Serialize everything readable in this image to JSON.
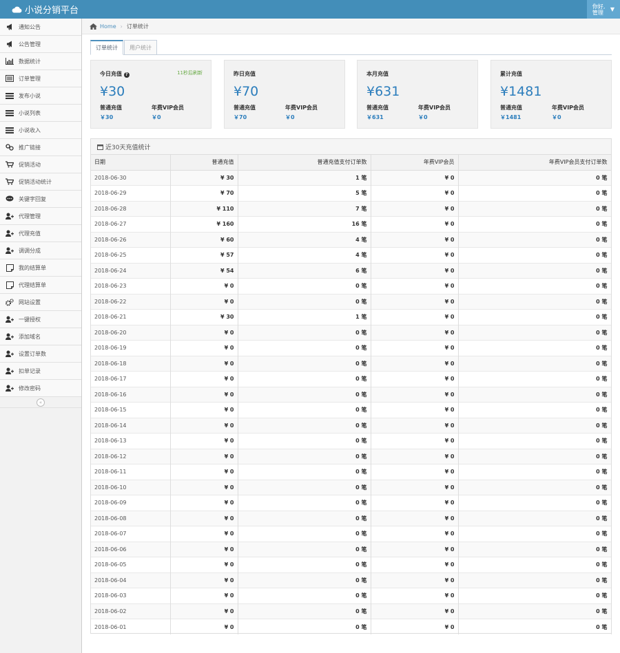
{
  "header": {
    "brand": "小说分销平台",
    "user_line1": "你好,",
    "user_line2": "管理"
  },
  "sidebar": {
    "items": [
      {
        "label": "通知公告",
        "icon": "bullhorn-icon"
      },
      {
        "label": "公告管理",
        "icon": "bullhorn-icon"
      },
      {
        "label": "数据统计",
        "icon": "bar-chart-icon"
      },
      {
        "label": "订单管理",
        "icon": "list-alt-icon"
      },
      {
        "label": "发布小说",
        "icon": "list-icon"
      },
      {
        "label": "小说列表",
        "icon": "list-icon"
      },
      {
        "label": "小说收入",
        "icon": "list-icon"
      },
      {
        "label": "推广链接",
        "icon": "link-icon"
      },
      {
        "label": "促销活动",
        "icon": "cart-icon"
      },
      {
        "label": "促销活动统计",
        "icon": "cart-icon"
      },
      {
        "label": "关键字回复",
        "icon": "comment-icon"
      },
      {
        "label": "代理管理",
        "icon": "user-plus-icon"
      },
      {
        "label": "代理充值",
        "icon": "user-plus-icon"
      },
      {
        "label": "调调分成",
        "icon": "user-plus-icon"
      },
      {
        "label": "我的结算单",
        "icon": "note-icon"
      },
      {
        "label": "代理结算单",
        "icon": "note-icon"
      },
      {
        "label": "网站设置",
        "icon": "cogs-icon"
      },
      {
        "label": "一键授权",
        "icon": "user-plus-icon"
      },
      {
        "label": "添加域名",
        "icon": "user-plus-icon"
      },
      {
        "label": "设置订单数",
        "icon": "user-plus-icon"
      },
      {
        "label": "扣单记录",
        "icon": "user-plus-icon"
      },
      {
        "label": "修改密码",
        "icon": "user-plus-icon"
      }
    ],
    "collapse_symbol": "«"
  },
  "breadcrumb": {
    "home": "Home",
    "current": "订单统计"
  },
  "tabs": [
    {
      "label": "订单统计",
      "active": true
    },
    {
      "label": "用户统计",
      "active": false
    }
  ],
  "stats": [
    {
      "title": "今日充值",
      "refresh": "11秒后刷新",
      "value": "¥30",
      "l1": "普通充值",
      "l2": "年费VIP会员",
      "v1": "￥30",
      "v2": "￥0"
    },
    {
      "title": "昨日充值",
      "refresh": "",
      "value": "¥70",
      "l1": "普通充值",
      "l2": "年费VIP会员",
      "v1": "￥70",
      "v2": "￥0"
    },
    {
      "title": "本月充值",
      "refresh": "",
      "value": "¥631",
      "l1": "普通充值",
      "l2": "年费VIP会员",
      "v1": "￥631",
      "v2": "￥0"
    },
    {
      "title": "累计充值",
      "refresh": "",
      "value": "¥1481",
      "l1": "普通充值",
      "l2": "年费VIP会员",
      "v1": "￥1481",
      "v2": "￥0"
    }
  ],
  "table": {
    "title": "近30天充值统计",
    "headers": [
      "日期",
      "普通充值",
      "普通充值支付订单数",
      "年费VIP会员",
      "年费VIP会员支付订单数"
    ],
    "rows": [
      [
        "2018-06-30",
        "¥ 30",
        "1 笔",
        "¥ 0",
        "0 笔"
      ],
      [
        "2018-06-29",
        "¥ 70",
        "5 笔",
        "¥ 0",
        "0 笔"
      ],
      [
        "2018-06-28",
        "¥ 110",
        "7 笔",
        "¥ 0",
        "0 笔"
      ],
      [
        "2018-06-27",
        "¥ 160",
        "16 笔",
        "¥ 0",
        "0 笔"
      ],
      [
        "2018-06-26",
        "¥ 60",
        "4 笔",
        "¥ 0",
        "0 笔"
      ],
      [
        "2018-06-25",
        "¥ 57",
        "4 笔",
        "¥ 0",
        "0 笔"
      ],
      [
        "2018-06-24",
        "¥ 54",
        "6 笔",
        "¥ 0",
        "0 笔"
      ],
      [
        "2018-06-23",
        "¥ 0",
        "0 笔",
        "¥ 0",
        "0 笔"
      ],
      [
        "2018-06-22",
        "¥ 0",
        "0 笔",
        "¥ 0",
        "0 笔"
      ],
      [
        "2018-06-21",
        "¥ 30",
        "1 笔",
        "¥ 0",
        "0 笔"
      ],
      [
        "2018-06-20",
        "¥ 0",
        "0 笔",
        "¥ 0",
        "0 笔"
      ],
      [
        "2018-06-19",
        "¥ 0",
        "0 笔",
        "¥ 0",
        "0 笔"
      ],
      [
        "2018-06-18",
        "¥ 0",
        "0 笔",
        "¥ 0",
        "0 笔"
      ],
      [
        "2018-06-17",
        "¥ 0",
        "0 笔",
        "¥ 0",
        "0 笔"
      ],
      [
        "2018-06-16",
        "¥ 0",
        "0 笔",
        "¥ 0",
        "0 笔"
      ],
      [
        "2018-06-15",
        "¥ 0",
        "0 笔",
        "¥ 0",
        "0 笔"
      ],
      [
        "2018-06-14",
        "¥ 0",
        "0 笔",
        "¥ 0",
        "0 笔"
      ],
      [
        "2018-06-13",
        "¥ 0",
        "0 笔",
        "¥ 0",
        "0 笔"
      ],
      [
        "2018-06-12",
        "¥ 0",
        "0 笔",
        "¥ 0",
        "0 笔"
      ],
      [
        "2018-06-11",
        "¥ 0",
        "0 笔",
        "¥ 0",
        "0 笔"
      ],
      [
        "2018-06-10",
        "¥ 0",
        "0 笔",
        "¥ 0",
        "0 笔"
      ],
      [
        "2018-06-09",
        "¥ 0",
        "0 笔",
        "¥ 0",
        "0 笔"
      ],
      [
        "2018-06-08",
        "¥ 0",
        "0 笔",
        "¥ 0",
        "0 笔"
      ],
      [
        "2018-06-07",
        "¥ 0",
        "0 笔",
        "¥ 0",
        "0 笔"
      ],
      [
        "2018-06-06",
        "¥ 0",
        "0 笔",
        "¥ 0",
        "0 笔"
      ],
      [
        "2018-06-05",
        "¥ 0",
        "0 笔",
        "¥ 0",
        "0 笔"
      ],
      [
        "2018-06-04",
        "¥ 0",
        "0 笔",
        "¥ 0",
        "0 笔"
      ],
      [
        "2018-06-03",
        "¥ 0",
        "0 笔",
        "¥ 0",
        "0 笔"
      ],
      [
        "2018-06-02",
        "¥ 0",
        "0 笔",
        "¥ 0",
        "0 笔"
      ],
      [
        "2018-06-01",
        "¥ 0",
        "0 笔",
        "¥ 0",
        "0 笔"
      ]
    ]
  },
  "colors": {
    "topbar": "#438eb9",
    "accent": "#2b7dbc",
    "refresh": "#69aa46"
  }
}
